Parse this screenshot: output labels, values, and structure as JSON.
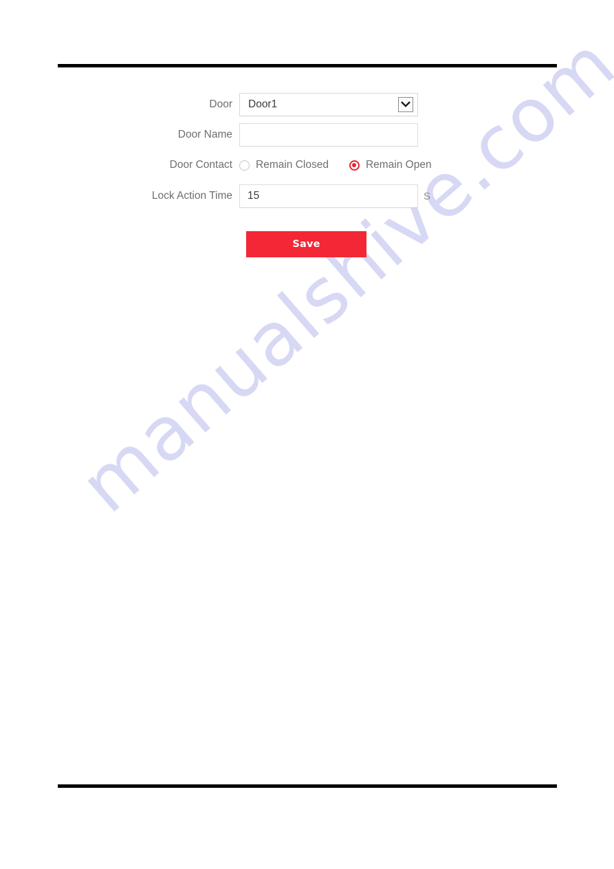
{
  "page": {
    "watermark": "manualshive.com",
    "background_color": "#ffffff",
    "rule_color": "#000000"
  },
  "form": {
    "fields": {
      "door": {
        "label": "Door",
        "selected_value": "Door1",
        "options": [
          "Door1"
        ],
        "arrow_icon": "chevron-down-icon"
      },
      "door_name": {
        "label": "Door Name",
        "value": "",
        "placeholder": ""
      },
      "door_contact": {
        "label": "Door Contact",
        "options": [
          {
            "label": "Remain Closed",
            "checked": false
          },
          {
            "label": "Remain Open",
            "checked": true
          }
        ]
      },
      "lock_action_time": {
        "label": "Lock Action Time",
        "value": "15",
        "placeholder": "",
        "unit": "S"
      }
    },
    "save_button": {
      "label": "Save",
      "color": "#f32735",
      "text_color": "#ffffff"
    }
  },
  "colors": {
    "accent_red": "#f32735",
    "radio_selected": "#e8222e",
    "label_grey": "#6e6e6e",
    "input_border": "#dcdcdc",
    "watermark": "#c9caf0"
  }
}
